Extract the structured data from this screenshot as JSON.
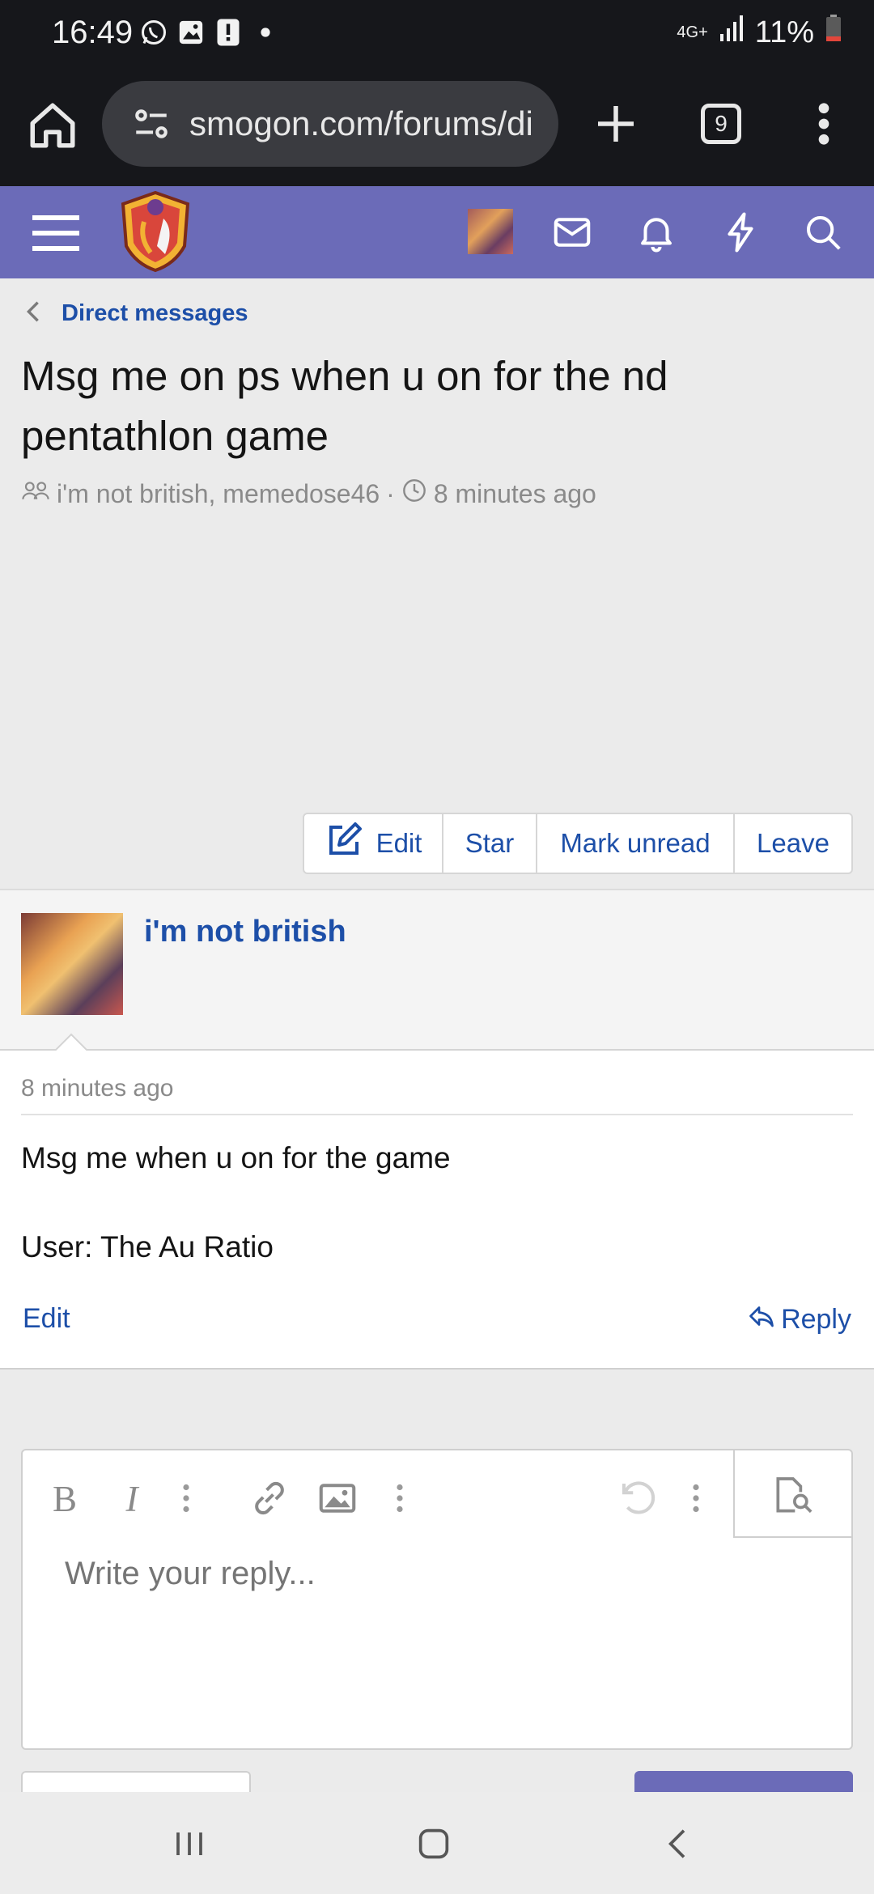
{
  "status_bar": {
    "time": "16:49",
    "network": "4G+",
    "battery": "11%"
  },
  "browser": {
    "url": "smogon.com/forums/di",
    "tab_count": "9"
  },
  "breadcrumb": {
    "label": "Direct messages"
  },
  "conversation": {
    "title": "Msg me on ps when u on for the nd pentathlon game",
    "participants": "i'm not british, memedose46",
    "separator": "·",
    "time": "8 minutes ago"
  },
  "actions": {
    "edit": "Edit",
    "star": "Star",
    "mark_unread": "Mark unread",
    "leave": "Leave"
  },
  "message": {
    "author": "i'm not british",
    "time": "8 minutes ago",
    "line1": "Msg me when u on for the game",
    "line2": "User: The Au Ratio",
    "edit_label": "Edit",
    "reply_label": "Reply"
  },
  "editor": {
    "placeholder": "Write your reply..."
  },
  "colors": {
    "brand": "#6b6bb8",
    "link": "#1d4fa8",
    "statusbar": "#16171b"
  }
}
